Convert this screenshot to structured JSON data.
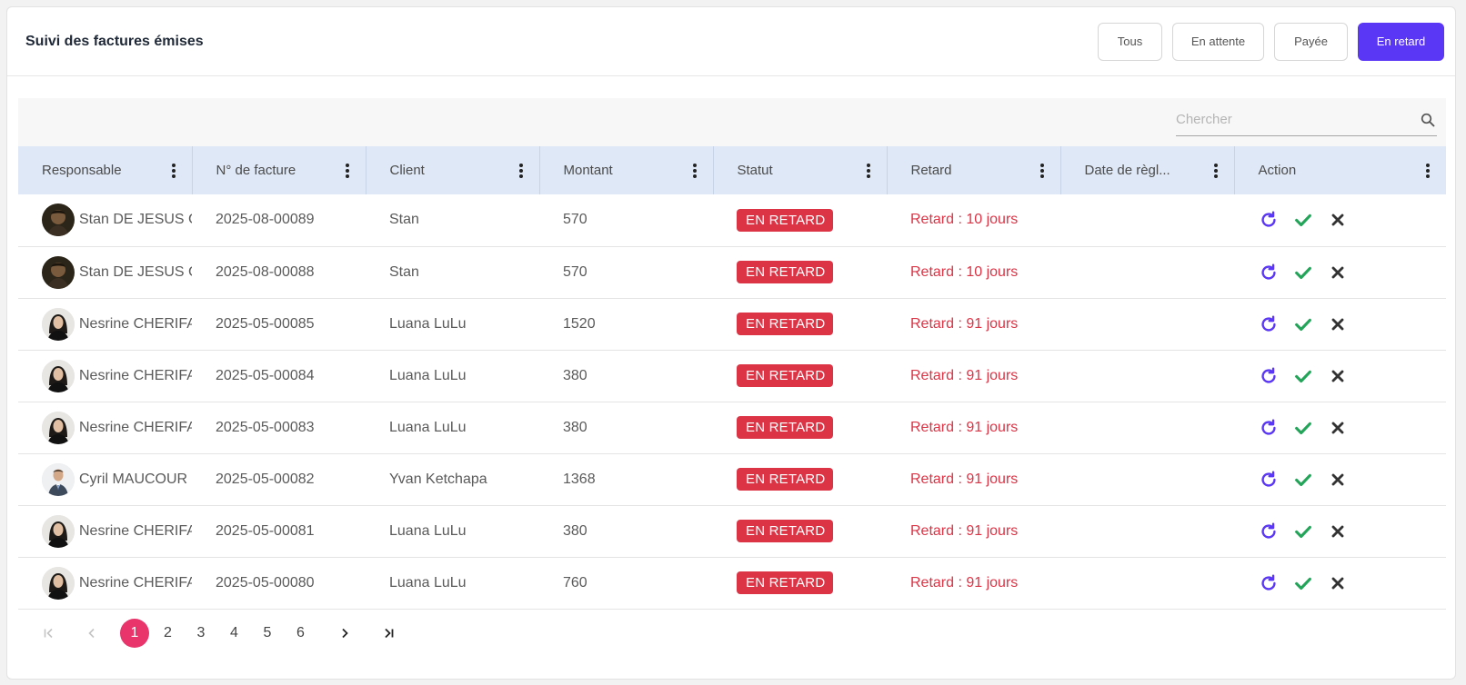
{
  "header": {
    "title": "Suivi des factures émises"
  },
  "filters": [
    {
      "label": "Tous",
      "active": false
    },
    {
      "label": "En attente",
      "active": false
    },
    {
      "label": "Payée",
      "active": false
    },
    {
      "label": "En retard",
      "active": true
    }
  ],
  "search": {
    "placeholder": "Chercher",
    "value": ""
  },
  "columns": [
    "Responsable",
    "N° de facture",
    "Client",
    "Montant",
    "Statut",
    "Retard",
    "Date de règl...",
    "Action"
  ],
  "rows": [
    {
      "responsable": "Stan DE JESUS C",
      "avatar": "avatar-stan",
      "invoice": "2025-08-00089",
      "client": "Stan",
      "amount": "570",
      "status": "EN RETARD",
      "delay": "Retard : 10 jours",
      "payment_date": ""
    },
    {
      "responsable": "Stan DE JESUS C",
      "avatar": "avatar-stan",
      "invoice": "2025-08-00088",
      "client": "Stan",
      "amount": "570",
      "status": "EN RETARD",
      "delay": "Retard : 10 jours",
      "payment_date": ""
    },
    {
      "responsable": "Nesrine CHERIFA",
      "avatar": "avatar-nesrine",
      "invoice": "2025-05-00085",
      "client": "Luana LuLu",
      "amount": "1520",
      "status": "EN RETARD",
      "delay": "Retard : 91 jours",
      "payment_date": ""
    },
    {
      "responsable": "Nesrine CHERIFA",
      "avatar": "avatar-nesrine",
      "invoice": "2025-05-00084",
      "client": "Luana LuLu",
      "amount": "380",
      "status": "EN RETARD",
      "delay": "Retard : 91 jours",
      "payment_date": ""
    },
    {
      "responsable": "Nesrine CHERIFA",
      "avatar": "avatar-nesrine",
      "invoice": "2025-05-00083",
      "client": "Luana LuLu",
      "amount": "380",
      "status": "EN RETARD",
      "delay": "Retard : 91 jours",
      "payment_date": ""
    },
    {
      "responsable": "Cyril MAUCOUR",
      "avatar": "avatar-cyril",
      "invoice": "2025-05-00082",
      "client": "Yvan Ketchapa",
      "amount": "1368",
      "status": "EN RETARD",
      "delay": "Retard : 91 jours",
      "payment_date": ""
    },
    {
      "responsable": "Nesrine CHERIFA",
      "avatar": "avatar-nesrine",
      "invoice": "2025-05-00081",
      "client": "Luana LuLu",
      "amount": "380",
      "status": "EN RETARD",
      "delay": "Retard : 91 jours",
      "payment_date": ""
    },
    {
      "responsable": "Nesrine CHERIFA",
      "avatar": "avatar-nesrine",
      "invoice": "2025-05-00080",
      "client": "Luana LuLu",
      "amount": "760",
      "status": "EN RETARD",
      "delay": "Retard : 91 jours",
      "payment_date": ""
    }
  ],
  "row_actions": [
    {
      "icon": "refresh-icon",
      "color": "#5a36f5"
    },
    {
      "icon": "check-icon",
      "color": "#22a559"
    },
    {
      "icon": "close-icon",
      "color": "#333333"
    }
  ],
  "pagination": {
    "pages": [
      "1",
      "2",
      "3",
      "4",
      "5",
      "6"
    ],
    "current": "1"
  },
  "colors": {
    "accent": "#5a36f5",
    "danger": "#dc3345",
    "page_active": "#e8336b",
    "header_bg": "#dfe8f6"
  }
}
